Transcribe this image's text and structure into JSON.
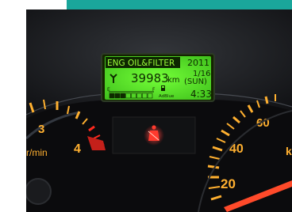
{
  "display": {
    "message": "ENG OIL&FILTER",
    "year": "2011",
    "odometer_value": "39983",
    "odometer_unit": "km",
    "date": "1/16",
    "weekday": "(SUN)",
    "time": "4:33",
    "fuel_empty_label": "E",
    "fuel_full_label": "F",
    "adblue_label": "AdBlue",
    "fuel_level_fraction": 0.35
  },
  "tachometer": {
    "unit_label": "r/min",
    "scale_labels": [
      "3",
      "4"
    ]
  },
  "speedometer": {
    "scale_labels": [
      "60",
      "40",
      "20"
    ],
    "edge_label": "k"
  },
  "colors": {
    "teal_bar": "#1aa69b",
    "lcd_background": "#5be02a",
    "gauge_amber": "#ffb030",
    "redline": "#ff2a1e",
    "seatbelt_warning": "#ff2a2a"
  },
  "icons": {
    "seatbelt": "seatbelt-warning-icon",
    "fuel_pump": "fuel-pump-icon",
    "oil": "wrench-service-icon"
  }
}
